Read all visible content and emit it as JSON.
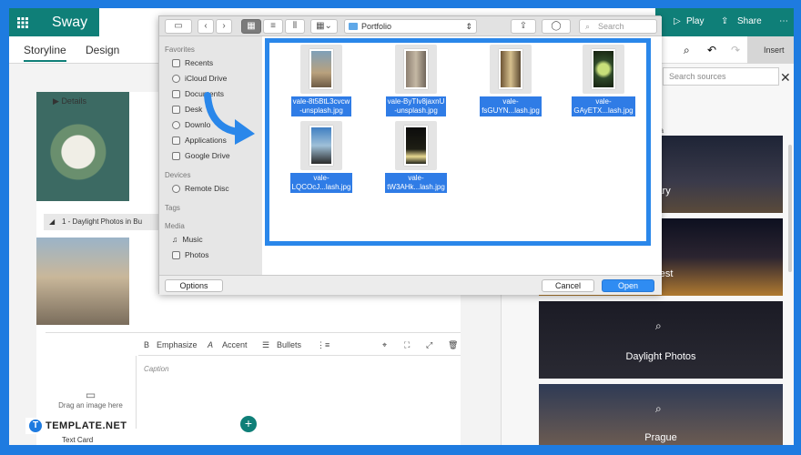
{
  "sway": {
    "brand": "Sway",
    "tabs": [
      "Storyline",
      "Design"
    ],
    "top_right": {
      "play": "Play",
      "share": "Share",
      "more": "⋯"
    },
    "details_tag": "Details",
    "section_bar": "1 - Daylight Photos in Bu",
    "format_bar": {
      "emphasize": "Emphasize",
      "accent": "Accent",
      "bullets": "Bullets"
    },
    "drag_text": "Drag an image here",
    "caption_placeholder": "Caption",
    "text_card_label": "Text Card",
    "add_button": "+"
  },
  "right_panel": {
    "insert_label": "Insert",
    "search_placeholder": "Search sources",
    "media_label": "edia",
    "tiles": [
      {
        "name": "gary"
      },
      {
        "name": "apest"
      },
      {
        "name": "Daylight Photos"
      },
      {
        "name": "Prague"
      }
    ]
  },
  "dialog": {
    "path": "Portfolio",
    "search_placeholder": "Search",
    "sidebar": {
      "favorites_label": "Favorites",
      "favorites": [
        "Recents",
        "iCloud Drive",
        "Documents",
        "Desk",
        "Downlo",
        "Applications",
        "Google Drive"
      ],
      "devices_label": "Devices",
      "devices": [
        "Remote Disc"
      ],
      "tags_label": "Tags",
      "media_label": "Media",
      "media": [
        "Music",
        "Photos"
      ]
    },
    "files": [
      {
        "line1": "vale-8t5BtL3cvcw",
        "line2": "-unsplash.jpg"
      },
      {
        "line1": "vale-ByTIv8jaxnU",
        "line2": "-unsplash.jpg"
      },
      {
        "line1": "vale-",
        "line2": "fsGUYN...lash.jpg"
      },
      {
        "line1": "vale-",
        "line2": "GAyETX...lash.jpg"
      },
      {
        "line1": "vale-",
        "line2": "LQCOcJ...lash.jpg"
      },
      {
        "line1": "vale-",
        "line2": "tW3AHk...lash.jpg"
      }
    ],
    "options_label": "Options",
    "cancel_label": "Cancel",
    "open_label": "Open"
  },
  "watermark": {
    "mark": "T",
    "text": "TEMPLATE.NET"
  }
}
